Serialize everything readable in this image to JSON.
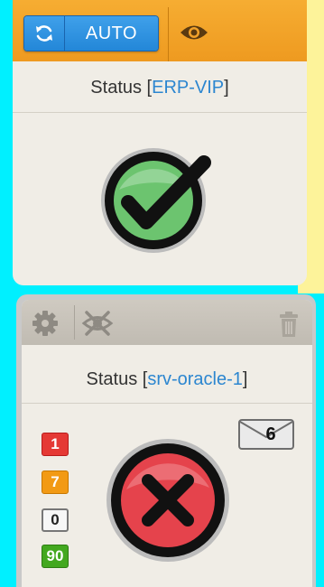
{
  "colors": {
    "page_background": "#00f0ff",
    "card_background": "#f0ede6",
    "accent_toolbar": "#f2a22a",
    "button_blue": "#2f93e0",
    "link_blue": "#2c86d0",
    "ok_green": "#6cc46f",
    "error_red": "#e5434c",
    "badge_red": "#e53935",
    "badge_orange": "#f29a14",
    "badge_green": "#43a81f"
  },
  "card1": {
    "toolbar": {
      "refresh_icon": "refresh-icon",
      "auto_label": "AUTO",
      "eye_icon": "eye-icon"
    },
    "title_prefix": "Status [",
    "title_name": "ERP-VIP",
    "title_suffix": "]",
    "status_icon": "check-circle-icon"
  },
  "card2": {
    "toolbar": {
      "settings_icon": "gear-icon",
      "hide_icon": "eye-off-icon",
      "delete_icon": "trash-icon"
    },
    "title_prefix": "Status [",
    "title_name": "srv-oracle-1",
    "title_suffix": "]",
    "status_icon": "x-circle-icon",
    "badges": [
      {
        "value": "1",
        "color": "red"
      },
      {
        "value": "7",
        "color": "orange"
      },
      {
        "value": "0",
        "color": "white"
      },
      {
        "value": "90",
        "color": "green"
      }
    ],
    "messages_count": "6",
    "messages_icon": "envelope-icon"
  }
}
